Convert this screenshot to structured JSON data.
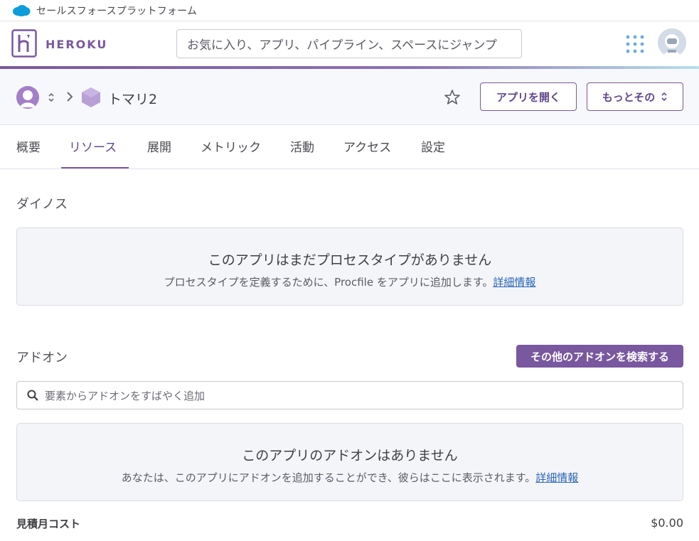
{
  "salesforce_bar": {
    "title": "セールスフォースプラットフォーム"
  },
  "header": {
    "brand": "HEROKU",
    "search_placeholder": "お気に入り、アプリ、パイプライン、スペースにジャンプ",
    "icons": [
      "heroku-logo-icon",
      "apps-grid-icon",
      "user-avatar-icon"
    ]
  },
  "app_header": {
    "app_name": "トマリ2",
    "open_app_label": "アプリを開く",
    "more_label": "もっとその"
  },
  "tabs": [
    {
      "label": "概要"
    },
    {
      "label": "リソース",
      "active": true
    },
    {
      "label": "展開"
    },
    {
      "label": "メトリック"
    },
    {
      "label": "活動"
    },
    {
      "label": "アクセス"
    },
    {
      "label": "設定"
    }
  ],
  "dynos": {
    "title": "ダイノス",
    "empty_heading": "このアプリはまだプロセスタイプがありません",
    "empty_text": "プロセスタイプを定義するために、Procfile をアプリに追加します。",
    "link": "詳細情報"
  },
  "addons": {
    "title": "アドオン",
    "find_button": "その他のアドオンを検索する",
    "search_placeholder": "要素からアドオンをすばやく追加",
    "empty_heading": "このアプリのアドオンはありません",
    "empty_text": "あなたは、このアプリにアドオンを追加することができ、彼らはここに表示されます。",
    "link": "詳細情報"
  },
  "cost": {
    "label": "見積月コスト",
    "value": "$0.00"
  },
  "colors": {
    "accent": "#79589f",
    "link": "#2964b8",
    "salesforce_blue": "#0d9dda"
  }
}
